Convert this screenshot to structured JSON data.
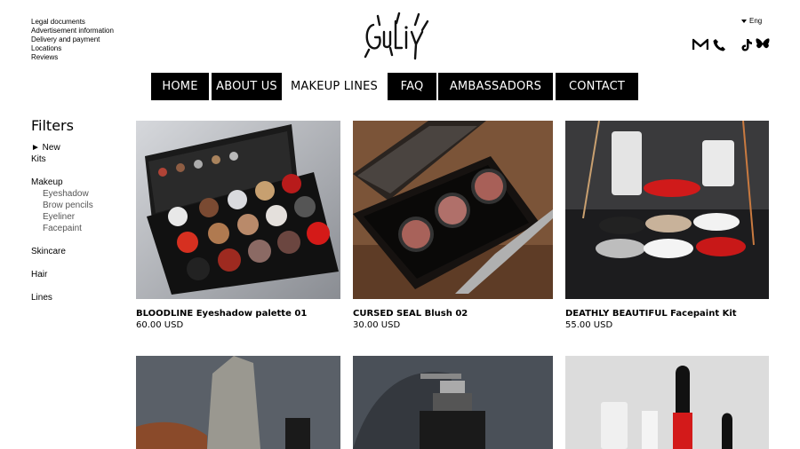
{
  "top_links": [
    "Legal documents",
    "Advertisement information",
    "Delivery and payment",
    "Locations",
    "Reviews"
  ],
  "brand": {
    "logo_text": "GuLiy"
  },
  "language": "Eng",
  "nav": [
    {
      "label": "HOME"
    },
    {
      "label": "ABOUT US"
    },
    {
      "label": "MAKEUP LINES",
      "active": true
    },
    {
      "label": "FAQ"
    },
    {
      "label": "AMBASSADORS"
    },
    {
      "label": "CONTACT"
    }
  ],
  "filters": {
    "title": "Filters",
    "new_label": "► New",
    "kits": "Kits",
    "makeup": "Makeup",
    "makeup_sub": [
      "Eyeshadow",
      "Brow pencils",
      "Eyeliner",
      "Facepaint"
    ],
    "skincare": "Skincare",
    "hair": "Hair",
    "lines": "Lines"
  },
  "products": [
    {
      "name": "BLOODLINE Eyeshadow palette 01",
      "price": "60.00 USD"
    },
    {
      "name": "CURSED SEAL Blush 02",
      "price": "30.00 USD"
    },
    {
      "name": "DEATHLY BEAUTIFUL Facepaint Kit",
      "price": "55.00 USD"
    }
  ],
  "colors": {
    "nav_bg": "#000000",
    "accent_red": "#c81d1d"
  }
}
